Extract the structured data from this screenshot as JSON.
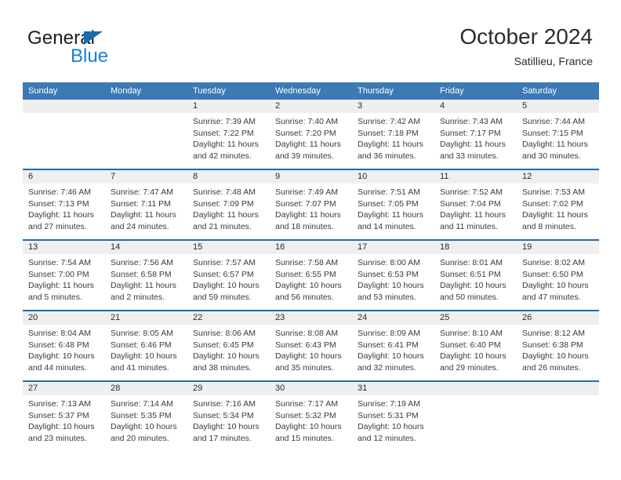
{
  "brand": {
    "name_top": "General",
    "name_bottom": "Blue",
    "accent_color": "#1b7fd4",
    "triangle_color": "#1b6cb0"
  },
  "header": {
    "title": "October 2024",
    "subtitle": "Satillieu, France",
    "header_bg": "#3b7ab4",
    "header_text_color": "#ffffff",
    "row_divider_color": "#1f6cb0",
    "daynum_band_color": "#efefef"
  },
  "weekday_headers": [
    "Sunday",
    "Monday",
    "Tuesday",
    "Wednesday",
    "Thursday",
    "Friday",
    "Saturday"
  ],
  "weeks": [
    [
      {
        "day": "",
        "lines": []
      },
      {
        "day": "",
        "lines": []
      },
      {
        "day": "1",
        "lines": [
          "Sunrise: 7:39 AM",
          "Sunset: 7:22 PM",
          "Daylight: 11 hours",
          "and 42 minutes."
        ]
      },
      {
        "day": "2",
        "lines": [
          "Sunrise: 7:40 AM",
          "Sunset: 7:20 PM",
          "Daylight: 11 hours",
          "and 39 minutes."
        ]
      },
      {
        "day": "3",
        "lines": [
          "Sunrise: 7:42 AM",
          "Sunset: 7:18 PM",
          "Daylight: 11 hours",
          "and 36 minutes."
        ]
      },
      {
        "day": "4",
        "lines": [
          "Sunrise: 7:43 AM",
          "Sunset: 7:17 PM",
          "Daylight: 11 hours",
          "and 33 minutes."
        ]
      },
      {
        "day": "5",
        "lines": [
          "Sunrise: 7:44 AM",
          "Sunset: 7:15 PM",
          "Daylight: 11 hours",
          "and 30 minutes."
        ]
      }
    ],
    [
      {
        "day": "6",
        "lines": [
          "Sunrise: 7:46 AM",
          "Sunset: 7:13 PM",
          "Daylight: 11 hours",
          "and 27 minutes."
        ]
      },
      {
        "day": "7",
        "lines": [
          "Sunrise: 7:47 AM",
          "Sunset: 7:11 PM",
          "Daylight: 11 hours",
          "and 24 minutes."
        ]
      },
      {
        "day": "8",
        "lines": [
          "Sunrise: 7:48 AM",
          "Sunset: 7:09 PM",
          "Daylight: 11 hours",
          "and 21 minutes."
        ]
      },
      {
        "day": "9",
        "lines": [
          "Sunrise: 7:49 AM",
          "Sunset: 7:07 PM",
          "Daylight: 11 hours",
          "and 18 minutes."
        ]
      },
      {
        "day": "10",
        "lines": [
          "Sunrise: 7:51 AM",
          "Sunset: 7:05 PM",
          "Daylight: 11 hours",
          "and 14 minutes."
        ]
      },
      {
        "day": "11",
        "lines": [
          "Sunrise: 7:52 AM",
          "Sunset: 7:04 PM",
          "Daylight: 11 hours",
          "and 11 minutes."
        ]
      },
      {
        "day": "12",
        "lines": [
          "Sunrise: 7:53 AM",
          "Sunset: 7:02 PM",
          "Daylight: 11 hours",
          "and 8 minutes."
        ]
      }
    ],
    [
      {
        "day": "13",
        "lines": [
          "Sunrise: 7:54 AM",
          "Sunset: 7:00 PM",
          "Daylight: 11 hours",
          "and 5 minutes."
        ]
      },
      {
        "day": "14",
        "lines": [
          "Sunrise: 7:56 AM",
          "Sunset: 6:58 PM",
          "Daylight: 11 hours",
          "and 2 minutes."
        ]
      },
      {
        "day": "15",
        "lines": [
          "Sunrise: 7:57 AM",
          "Sunset: 6:57 PM",
          "Daylight: 10 hours",
          "and 59 minutes."
        ]
      },
      {
        "day": "16",
        "lines": [
          "Sunrise: 7:58 AM",
          "Sunset: 6:55 PM",
          "Daylight: 10 hours",
          "and 56 minutes."
        ]
      },
      {
        "day": "17",
        "lines": [
          "Sunrise: 8:00 AM",
          "Sunset: 6:53 PM",
          "Daylight: 10 hours",
          "and 53 minutes."
        ]
      },
      {
        "day": "18",
        "lines": [
          "Sunrise: 8:01 AM",
          "Sunset: 6:51 PM",
          "Daylight: 10 hours",
          "and 50 minutes."
        ]
      },
      {
        "day": "19",
        "lines": [
          "Sunrise: 8:02 AM",
          "Sunset: 6:50 PM",
          "Daylight: 10 hours",
          "and 47 minutes."
        ]
      }
    ],
    [
      {
        "day": "20",
        "lines": [
          "Sunrise: 8:04 AM",
          "Sunset: 6:48 PM",
          "Daylight: 10 hours",
          "and 44 minutes."
        ]
      },
      {
        "day": "21",
        "lines": [
          "Sunrise: 8:05 AM",
          "Sunset: 6:46 PM",
          "Daylight: 10 hours",
          "and 41 minutes."
        ]
      },
      {
        "day": "22",
        "lines": [
          "Sunrise: 8:06 AM",
          "Sunset: 6:45 PM",
          "Daylight: 10 hours",
          "and 38 minutes."
        ]
      },
      {
        "day": "23",
        "lines": [
          "Sunrise: 8:08 AM",
          "Sunset: 6:43 PM",
          "Daylight: 10 hours",
          "and 35 minutes."
        ]
      },
      {
        "day": "24",
        "lines": [
          "Sunrise: 8:09 AM",
          "Sunset: 6:41 PM",
          "Daylight: 10 hours",
          "and 32 minutes."
        ]
      },
      {
        "day": "25",
        "lines": [
          "Sunrise: 8:10 AM",
          "Sunset: 6:40 PM",
          "Daylight: 10 hours",
          "and 29 minutes."
        ]
      },
      {
        "day": "26",
        "lines": [
          "Sunrise: 8:12 AM",
          "Sunset: 6:38 PM",
          "Daylight: 10 hours",
          "and 26 minutes."
        ]
      }
    ],
    [
      {
        "day": "27",
        "lines": [
          "Sunrise: 7:13 AM",
          "Sunset: 5:37 PM",
          "Daylight: 10 hours",
          "and 23 minutes."
        ]
      },
      {
        "day": "28",
        "lines": [
          "Sunrise: 7:14 AM",
          "Sunset: 5:35 PM",
          "Daylight: 10 hours",
          "and 20 minutes."
        ]
      },
      {
        "day": "29",
        "lines": [
          "Sunrise: 7:16 AM",
          "Sunset: 5:34 PM",
          "Daylight: 10 hours",
          "and 17 minutes."
        ]
      },
      {
        "day": "30",
        "lines": [
          "Sunrise: 7:17 AM",
          "Sunset: 5:32 PM",
          "Daylight: 10 hours",
          "and 15 minutes."
        ]
      },
      {
        "day": "31",
        "lines": [
          "Sunrise: 7:19 AM",
          "Sunset: 5:31 PM",
          "Daylight: 10 hours",
          "and 12 minutes."
        ]
      },
      {
        "day": "",
        "lines": []
      },
      {
        "day": "",
        "lines": []
      }
    ]
  ]
}
